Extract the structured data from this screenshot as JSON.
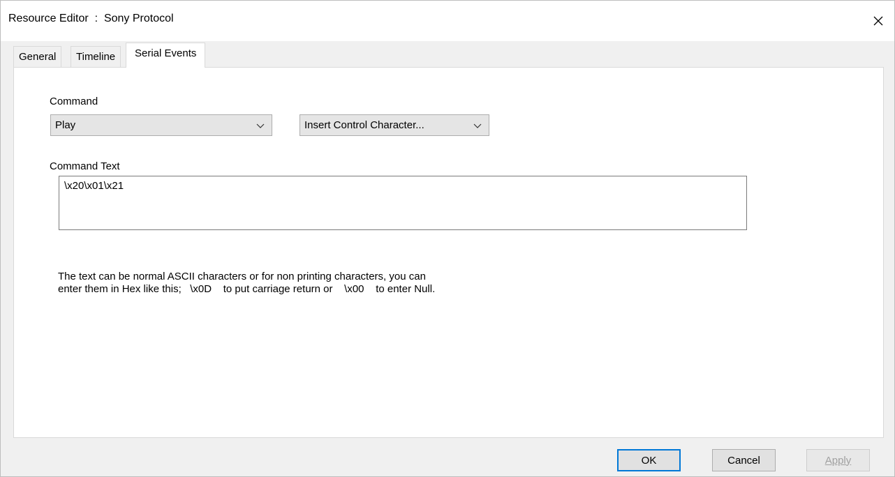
{
  "window": {
    "title": "Resource Editor  :  Sony Protocol"
  },
  "tabs": [
    {
      "label": "General"
    },
    {
      "label": "Timeline"
    },
    {
      "label": "Serial Events"
    }
  ],
  "serial_events": {
    "command_label": "Command",
    "command_value": "Play",
    "control_char_value": "Insert Control Character...",
    "command_text_label": "Command Text",
    "command_text_value": "\\x20\\x01\\x21",
    "help_line1": "The text can be normal ASCII characters or for non printing characters, you can",
    "help_line2": "enter them in Hex like this;   \\x0D    to put carriage return or    \\x00    to enter Null."
  },
  "buttons": {
    "ok": "OK",
    "cancel": "Cancel",
    "apply": "Apply"
  },
  "colors": {
    "default_button_border": "#0078d7",
    "panel_background": "#ffffff",
    "dialog_background": "#f0f0f0"
  }
}
